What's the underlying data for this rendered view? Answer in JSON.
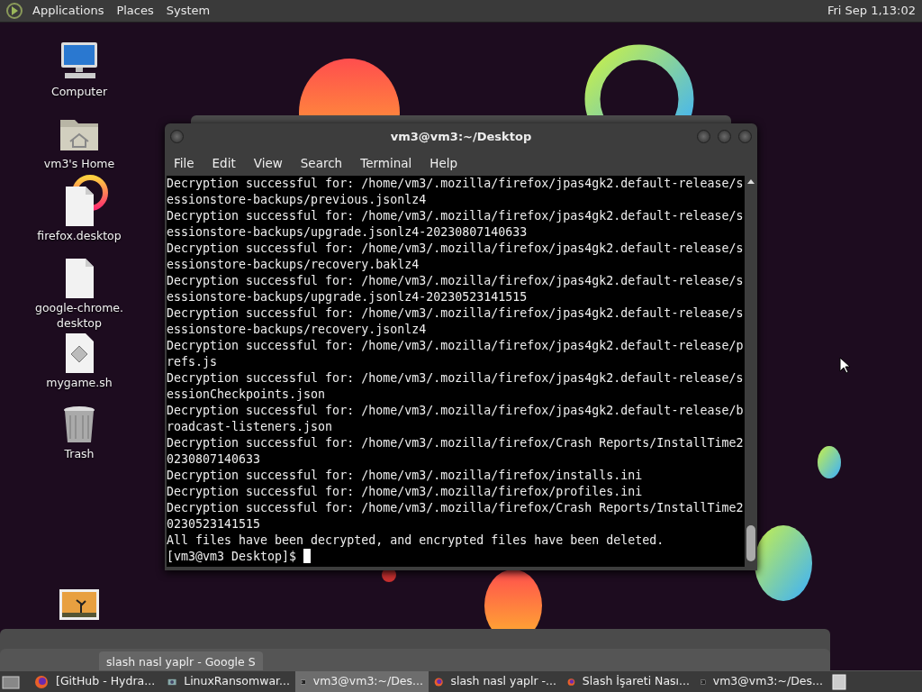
{
  "top_panel": {
    "menus": [
      "Applications",
      "Places",
      "System"
    ],
    "clock": "Fri Sep  1,13:02"
  },
  "desktop_icons": [
    {
      "kind": "computer",
      "label": "Computer"
    },
    {
      "kind": "home",
      "label": "vm3's Home"
    },
    {
      "kind": "file",
      "label": "firefox.desktop"
    },
    {
      "kind": "file",
      "label": "google-chrome.\ndesktop"
    },
    {
      "kind": "script",
      "label": "mygame.sh"
    },
    {
      "kind": "trash",
      "label": "Trash"
    },
    {
      "kind": "image"
    }
  ],
  "terminal": {
    "title": "vm3@vm3:~/Desktop",
    "menu": [
      "File",
      "Edit",
      "View",
      "Search",
      "Terminal",
      "Help"
    ],
    "lines": [
      "Decryption successful for: /home/vm3/.mozilla/firefox/jpas4gk2.default-release/sessionstore-backups/previous.jsonlz4",
      "Decryption successful for: /home/vm3/.mozilla/firefox/jpas4gk2.default-release/sessionstore-backups/upgrade.jsonlz4-20230807140633",
      "Decryption successful for: /home/vm3/.mozilla/firefox/jpas4gk2.default-release/sessionstore-backups/recovery.baklz4",
      "Decryption successful for: /home/vm3/.mozilla/firefox/jpas4gk2.default-release/sessionstore-backups/upgrade.jsonlz4-20230523141515",
      "Decryption successful for: /home/vm3/.mozilla/firefox/jpas4gk2.default-release/sessionstore-backups/recovery.jsonlz4",
      "Decryption successful for: /home/vm3/.mozilla/firefox/jpas4gk2.default-release/prefs.js",
      "Decryption successful for: /home/vm3/.mozilla/firefox/jpas4gk2.default-release/sessionCheckpoints.json",
      "Decryption successful for: /home/vm3/.mozilla/firefox/jpas4gk2.default-release/broadcast-listeners.json",
      "Decryption successful for: /home/vm3/.mozilla/firefox/Crash Reports/InstallTime20230807140633",
      "Decryption successful for: /home/vm3/.mozilla/firefox/installs.ini",
      "Decryption successful for: /home/vm3/.mozilla/firefox/profiles.ini",
      "Decryption successful for: /home/vm3/.mozilla/firefox/Crash Reports/InstallTime20230523141515",
      "All files have been decrypted, and encrypted files have been deleted."
    ],
    "prompt": "[vm3@vm3 Desktop]$"
  },
  "background_window": {
    "tab_title": "slash nasl yaplr - Google S"
  },
  "taskbar": [
    {
      "kind": "firefox",
      "label": "[GitHub - Hydra...",
      "selected": false
    },
    {
      "kind": "app",
      "label": "LinuxRansomwar...",
      "selected": false
    },
    {
      "kind": "terminal",
      "label": "vm3@vm3:~/Des...",
      "selected": true
    },
    {
      "kind": "firefox",
      "label": "slash nasl yaplr -...",
      "selected": false
    },
    {
      "kind": "firefox",
      "label": "Slash İşareti Nası...",
      "selected": false
    },
    {
      "kind": "terminal",
      "label": "vm3@vm3:~/Des...",
      "selected": false
    }
  ]
}
